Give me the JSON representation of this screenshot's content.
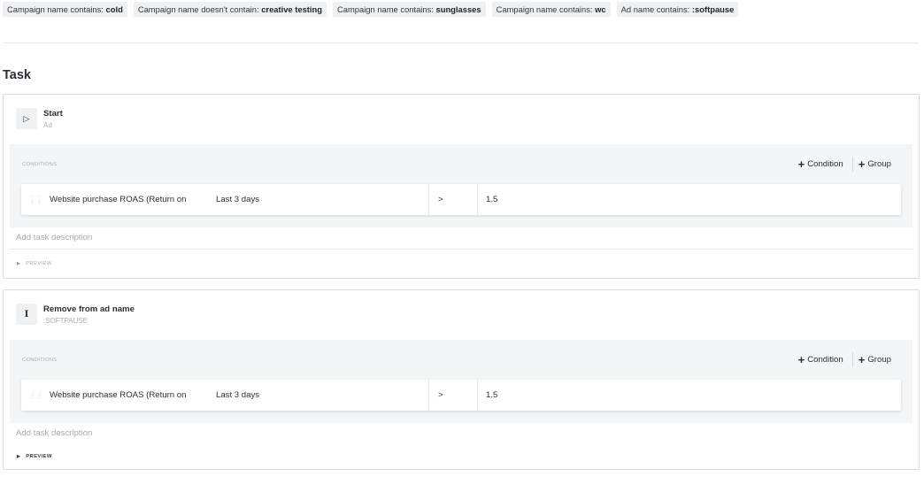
{
  "filters": [
    {
      "prefix": "Campaign name contains: ",
      "value": "cold"
    },
    {
      "prefix": "Campaign name doesn't contain: ",
      "value": "creative testing"
    },
    {
      "prefix": "Campaign name contains: ",
      "value": "sunglasses"
    },
    {
      "prefix": "Campaign name contains: ",
      "value": "wc"
    },
    {
      "prefix": "Ad name contains: ",
      "value": ":softpause"
    }
  ],
  "section_title": "Task",
  "tasks": [
    {
      "title": "Start",
      "subtitle": "Ad",
      "icon": "play-icon",
      "conditions_label": "CONDITIONS",
      "add_condition": "Condition",
      "add_group": "Group",
      "rule": {
        "metric": "Website purchase ROAS (Return on",
        "period": "Last 3 days",
        "operator": ">",
        "value": "1.5"
      },
      "description_placeholder": "Add task description",
      "preview_label": "PREVIEW"
    },
    {
      "title": "Remove from ad name",
      "subtitle": ":SOFTPAUSE",
      "icon": "text-cursor-icon",
      "conditions_label": "CONDITIONS",
      "add_condition": "Condition",
      "add_group": "Group",
      "rule": {
        "metric": "Website purchase ROAS (Return on",
        "period": "Last 3 days",
        "operator": ">",
        "value": "1.5"
      },
      "description_placeholder": "Add task description",
      "preview_label": "PREVIEW"
    }
  ]
}
